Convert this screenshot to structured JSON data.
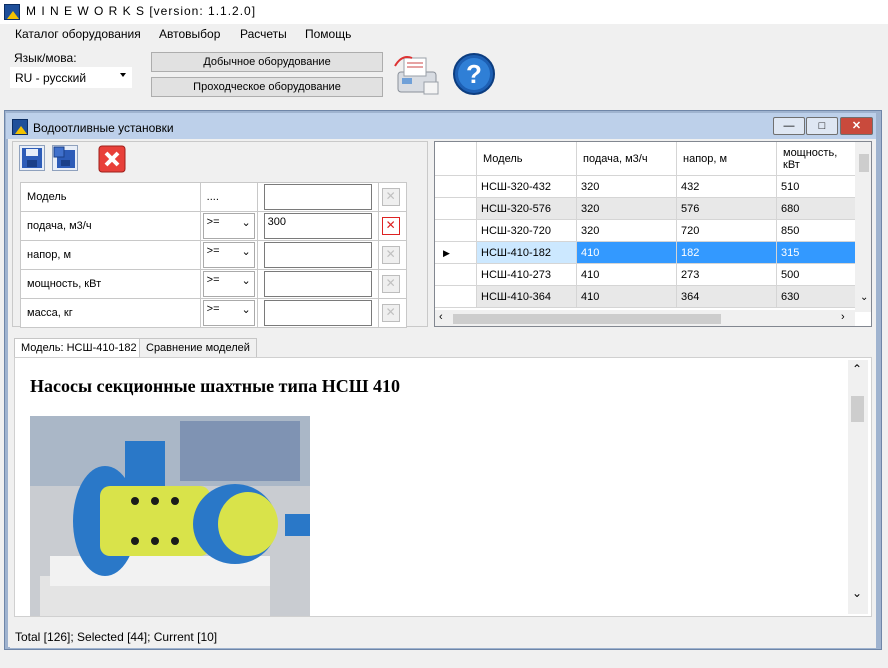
{
  "app": {
    "title": "M I N E W O R K S [version: 1.1.2.0]"
  },
  "menu": [
    "Каталог оборудования",
    "Автовыбор",
    "Расчеты",
    "Помощь"
  ],
  "lang": {
    "label": "Язык/мова:",
    "value": "RU - русский"
  },
  "buttons": {
    "mining": "Добычное оборудование",
    "tunneling": "Проходческое оборудование"
  },
  "child_window": {
    "title": "Водоотливные установки"
  },
  "filter": {
    "header": {
      "col1": "Модель",
      "col2": "...."
    },
    "rows": [
      {
        "label": "подача, м3/ч",
        "op": ">=",
        "value": "300"
      },
      {
        "label": "напор, м",
        "op": ">=",
        "value": ""
      },
      {
        "label": "мощность, кВт",
        "op": ">=",
        "value": ""
      },
      {
        "label": "масса, кг",
        "op": ">=",
        "value": ""
      }
    ]
  },
  "grid": {
    "headers": [
      "Модель",
      "подача, м3/ч",
      "напор, м",
      "мощность, кВт"
    ],
    "rows": [
      [
        "НСШ-320-432",
        "320",
        "432",
        "510"
      ],
      [
        "НСШ-320-576",
        "320",
        "576",
        "680"
      ],
      [
        "НСШ-320-720",
        "320",
        "720",
        "850"
      ],
      [
        "НСШ-410-182",
        "410",
        "182",
        "315"
      ],
      [
        "НСШ-410-273",
        "410",
        "273",
        "500"
      ],
      [
        "НСШ-410-364",
        "410",
        "364",
        "630"
      ]
    ],
    "selected_index": 3,
    "colors": {
      "selected_row": "#3399ff",
      "selected_model": "#cce8ff",
      "alt_row": "#e8e8e8"
    }
  },
  "tabs": [
    "Модель: НСШ-410-182",
    "Сравнение моделей"
  ],
  "doc": {
    "heading": "Насосы секционные шахтные типа НСШ 410"
  },
  "status": "Total [126]; Selected [44]; Current [10]"
}
